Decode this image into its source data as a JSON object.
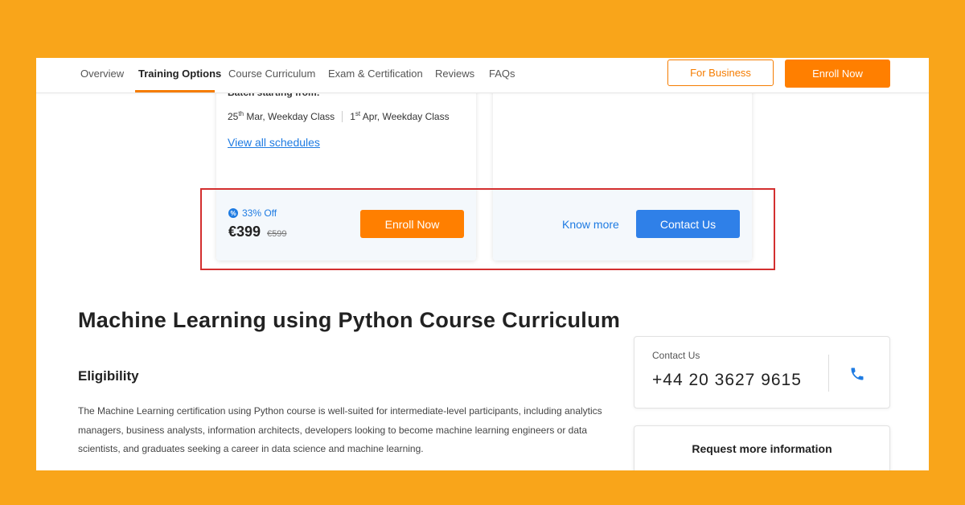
{
  "nav": {
    "tabs": [
      "Overview",
      "Training Options",
      "Course Curriculum",
      "Exam & Certification",
      "Reviews",
      "FAQs"
    ],
    "active_tab": "Training Options",
    "for_business": "For Business",
    "enroll_now": "Enroll Now"
  },
  "card_left": {
    "batch_title": "Batch starting from:",
    "batch1_day": "25",
    "batch1_suffix": "th",
    "batch1_rest": " Mar, Weekday Class",
    "batch2_day": "1",
    "batch2_suffix": "st",
    "batch2_rest": " Apr, Weekday Class",
    "view_all": "View all schedules",
    "discount": "33% Off",
    "price": "€399",
    "old_price": "€599",
    "enroll": "Enroll Now"
  },
  "card_right": {
    "know_more": "Know more",
    "contact": "Contact Us"
  },
  "curriculum": {
    "title_regular": "Machine Learning using Python Course ",
    "title_bold": "Curriculum",
    "eligibility_heading": "Eligibility",
    "eligibility_text": "The Machine Learning certification using Python course is well-suited for intermediate-level participants, including analytics managers, business analysts, information architects, developers looking to become machine learning engineers or data scientists, and graduates seeking a career in data science and machine learning."
  },
  "contact_box": {
    "label": "Contact Us",
    "phone": "+44 20 3627 9615"
  },
  "request_box": {
    "label": "Request more information"
  },
  "colors": {
    "background": "#F9A51A",
    "accent_orange": "#FF7F00",
    "link_blue": "#1E7BE2",
    "highlight_red": "#D32F2F"
  },
  "icons": [
    "discount-badge-icon",
    "phone-icon"
  ]
}
